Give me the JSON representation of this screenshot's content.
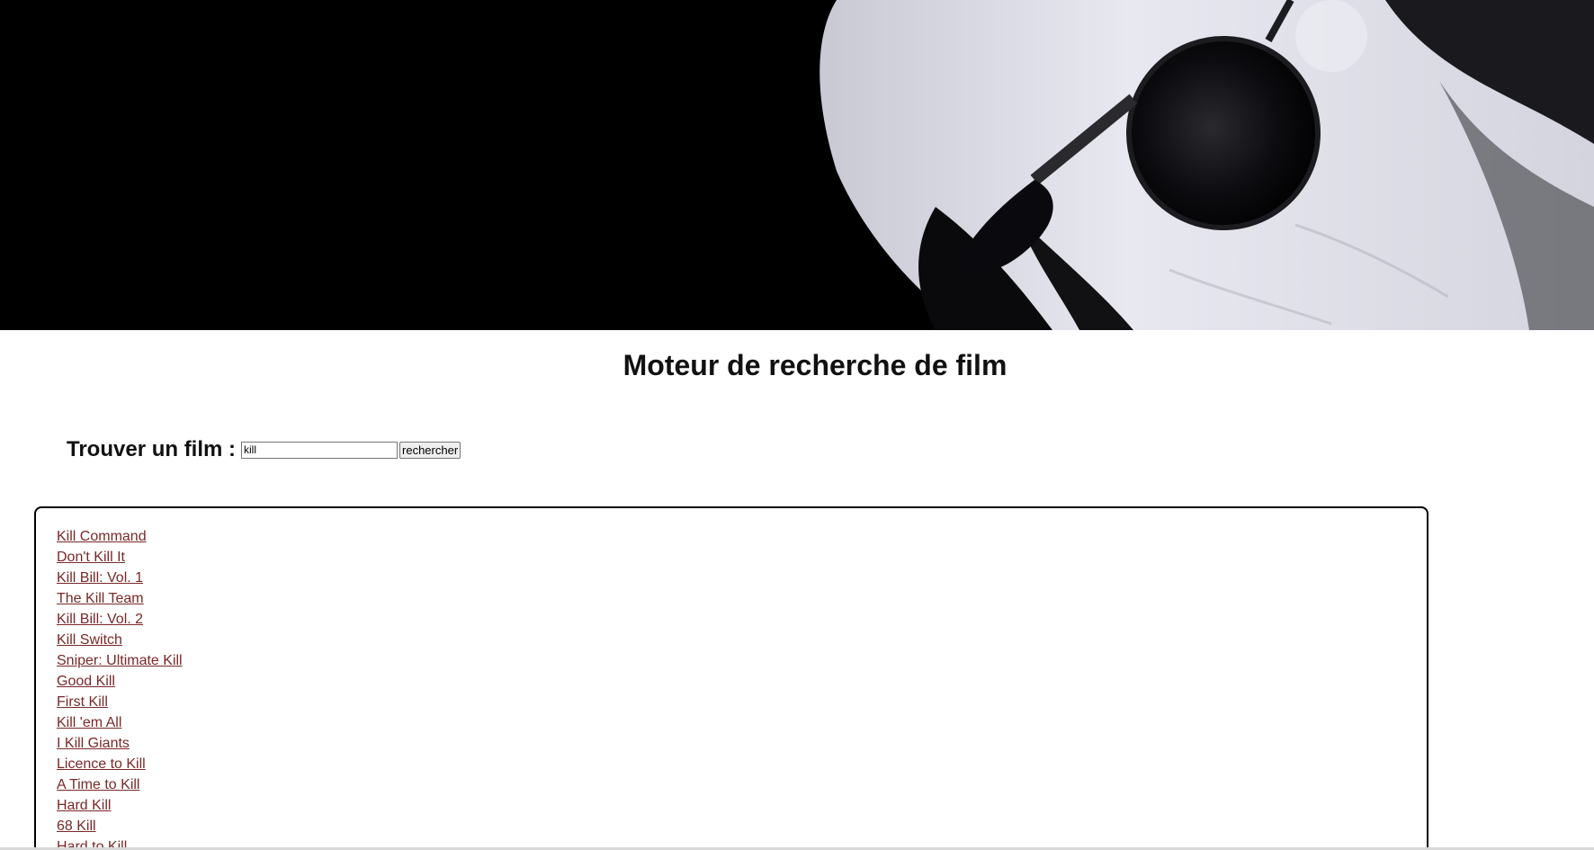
{
  "header": {
    "title": "Moteur de recherche de film"
  },
  "search": {
    "label": "Trouver un film :",
    "value": "kill",
    "button_label": "rechercher"
  },
  "results": [
    "Kill Command",
    "Don't Kill It",
    "Kill Bill: Vol. 1",
    "The Kill Team",
    "Kill Bill: Vol. 2",
    "Kill Switch",
    "Sniper: Ultimate Kill",
    "Good Kill",
    "First Kill",
    "Kill 'em All",
    "I Kill Giants",
    "Licence to Kill",
    "A Time to Kill",
    "Hard Kill",
    "68 Kill",
    "Hard to Kill"
  ],
  "colors": {
    "link": "#7a2828",
    "banner_background": "#000000",
    "banner_highlight": "#e2e2ec"
  }
}
